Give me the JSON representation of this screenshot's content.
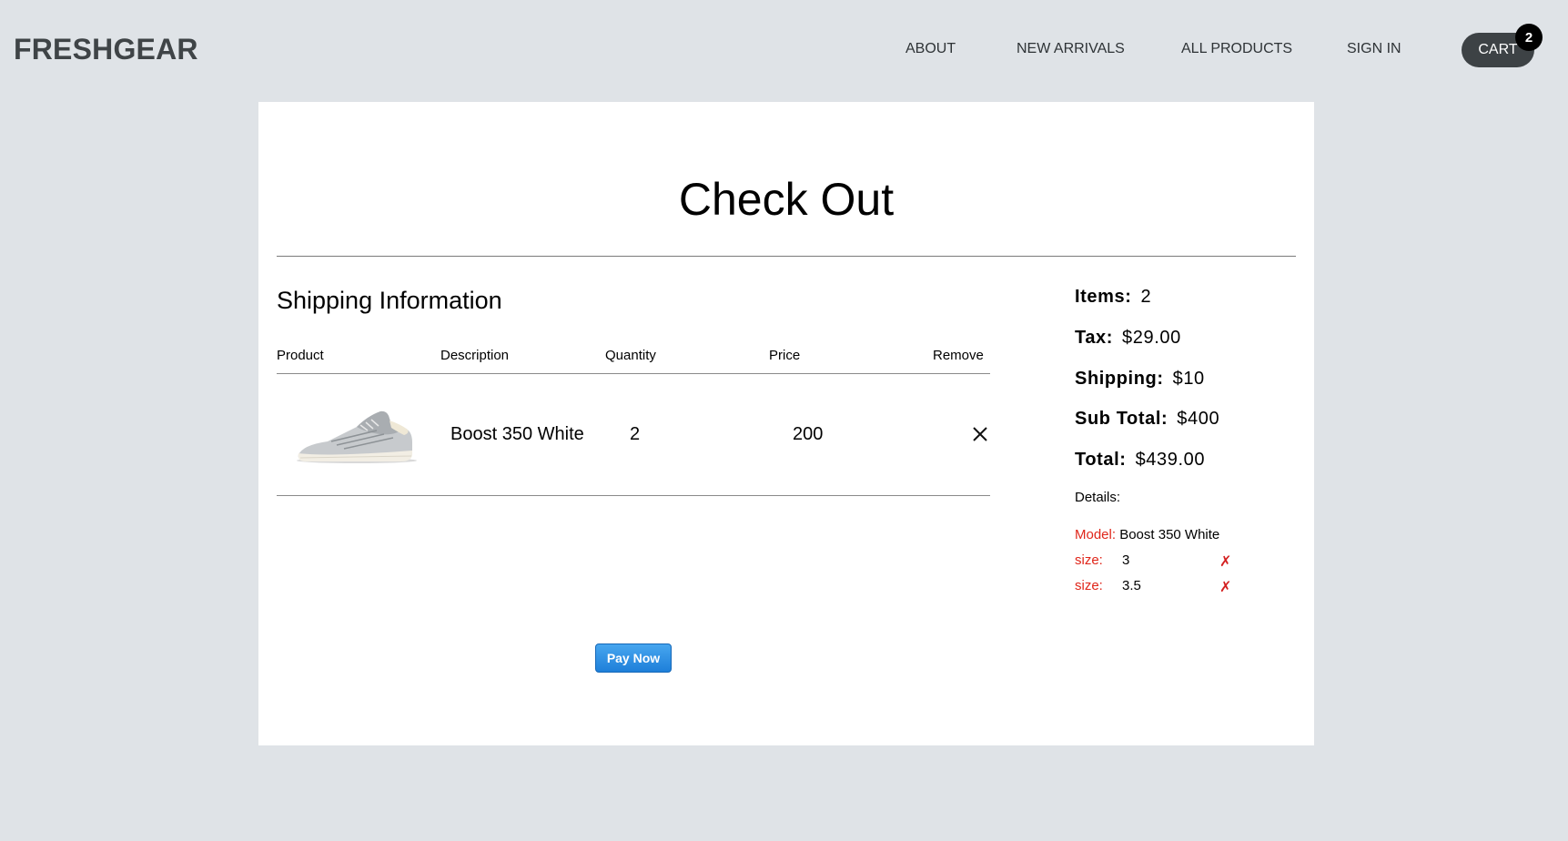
{
  "header": {
    "logo": "FRESHGEAR",
    "nav": [
      "ABOUT",
      "NEW ARRIVALS",
      "ALL PRODUCTS",
      "SIGN IN"
    ],
    "cart_label": "CART",
    "cart_count": "2"
  },
  "checkout": {
    "title": "Check Out",
    "section_title": "Shipping Information",
    "columns": [
      "Product",
      "Description",
      "Quantity",
      "Price",
      "Remove"
    ],
    "rows": [
      {
        "description": "Boost 350 White",
        "quantity": "2",
        "price": "200",
        "image_icon": "sneaker-image"
      }
    ],
    "pay_button": "Pay Now"
  },
  "summary": {
    "items_label": "Items:",
    "items_value": "2",
    "tax_label": "Tax:",
    "tax_value": "$29.00",
    "shipping_label": "Shipping:",
    "shipping_value": "$10",
    "subtotal_label": "Sub Total:",
    "subtotal_value": "$400",
    "total_label": "Total:",
    "total_value": "$439.00",
    "details_label": "Details:",
    "model_label": "Model:",
    "model_value": "Boost 350 White",
    "sizes": [
      {
        "label": "size:",
        "value": "3",
        "remove": "✗"
      },
      {
        "label": "size:",
        "value": "3.5",
        "remove": "✗"
      }
    ]
  },
  "colors": {
    "background": "#dfe3e7",
    "accent_red": "#e0261a",
    "pay_button": "#1e7fd9",
    "cart_button": "#3d4245"
  }
}
